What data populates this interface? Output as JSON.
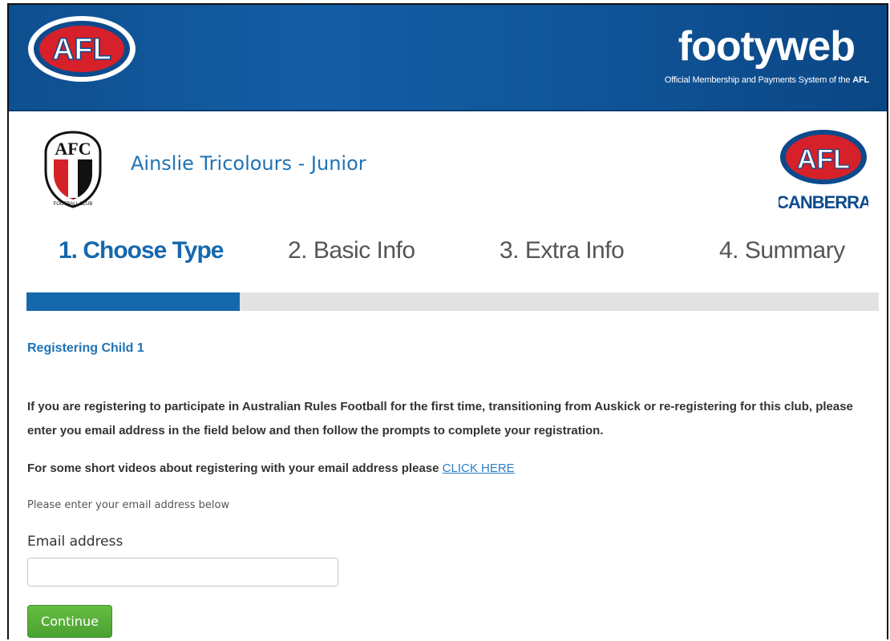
{
  "header": {
    "league_logo_text": "AFL",
    "brand": "footyweb",
    "tagline_prefix": "Official Membership and Payments System of the ",
    "tagline_bold": "AFL"
  },
  "club": {
    "name": "Ainslie Tricolours - Junior",
    "badge_text": "AFC",
    "badge_ring_text": "FOOTBALL CLUB",
    "partner_logo_text": "AFL",
    "partner_region": "CANBERRA"
  },
  "steps": [
    {
      "label": "1. Choose Type",
      "active": true
    },
    {
      "label": "2. Basic Info",
      "active": false
    },
    {
      "label": "3. Extra Info",
      "active": false
    },
    {
      "label": "4. Summary",
      "active": false
    }
  ],
  "progress": {
    "value": 0.25,
    "track_color": "#e2e2e2",
    "fill_color": "#1668ad"
  },
  "form": {
    "heading": "Registering Child 1",
    "intro": "If you are registering to participate in Australian Rules Football for the first time, transitioning from Auskick or re-registering for this club, please enter you email address in the field below and then follow the prompts to complete your registration.",
    "videos_text": "For some short videos about registering with your email address please ",
    "videos_link": "CLICK HERE",
    "hint": "Please enter your email address below",
    "email_label": "Email address",
    "email_value": "",
    "continue_label": "Continue"
  },
  "colors": {
    "header_blue": "#145ea5",
    "accent_blue": "#1f73b4",
    "button_green": "#4aa22f"
  }
}
